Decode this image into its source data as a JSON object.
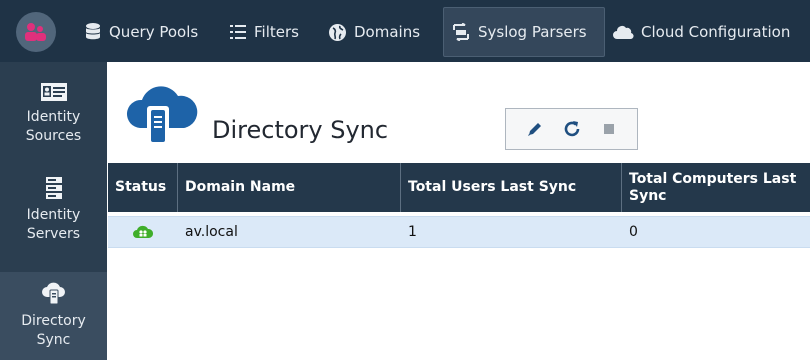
{
  "topnav": {
    "items": [
      {
        "label": "Query Pools",
        "icon": "database-icon"
      },
      {
        "label": "Filters",
        "icon": "list-icon"
      },
      {
        "label": "Domains",
        "icon": "globe-icon"
      },
      {
        "label": "Syslog Parsers",
        "icon": "parser-icon"
      },
      {
        "label": "Cloud Configuration",
        "icon": "cloud-icon"
      }
    ],
    "active": "Syslog Parsers"
  },
  "sidebar": {
    "items": [
      {
        "label_line1": "Identity",
        "label_line2": "Sources",
        "icon": "id-card-icon"
      },
      {
        "label_line1": "Identity",
        "label_line2": "Servers",
        "icon": "server-icon"
      },
      {
        "label_line1": "Directory",
        "label_line2": "Sync",
        "icon": "cloud-sync-icon"
      }
    ],
    "selected": "Directory Sync"
  },
  "page": {
    "title": "Directory Sync"
  },
  "toolbar": {
    "buttons": [
      "edit-icon",
      "refresh-icon",
      "stop-icon"
    ]
  },
  "table": {
    "columns": [
      "Status",
      "Domain Name",
      "Total Users Last Sync",
      "Total Computers Last Sync"
    ],
    "rows": [
      {
        "status": "connected",
        "domain": "av.local",
        "users": "1",
        "computers": "0"
      }
    ]
  },
  "colors": {
    "topbar": "#1f3346",
    "sidebar": "#2b3e50",
    "table_header": "#24384b",
    "selected_row": "#dbe9f8",
    "status_ok": "#3fae2a",
    "logo_accent": "#e0307c"
  }
}
